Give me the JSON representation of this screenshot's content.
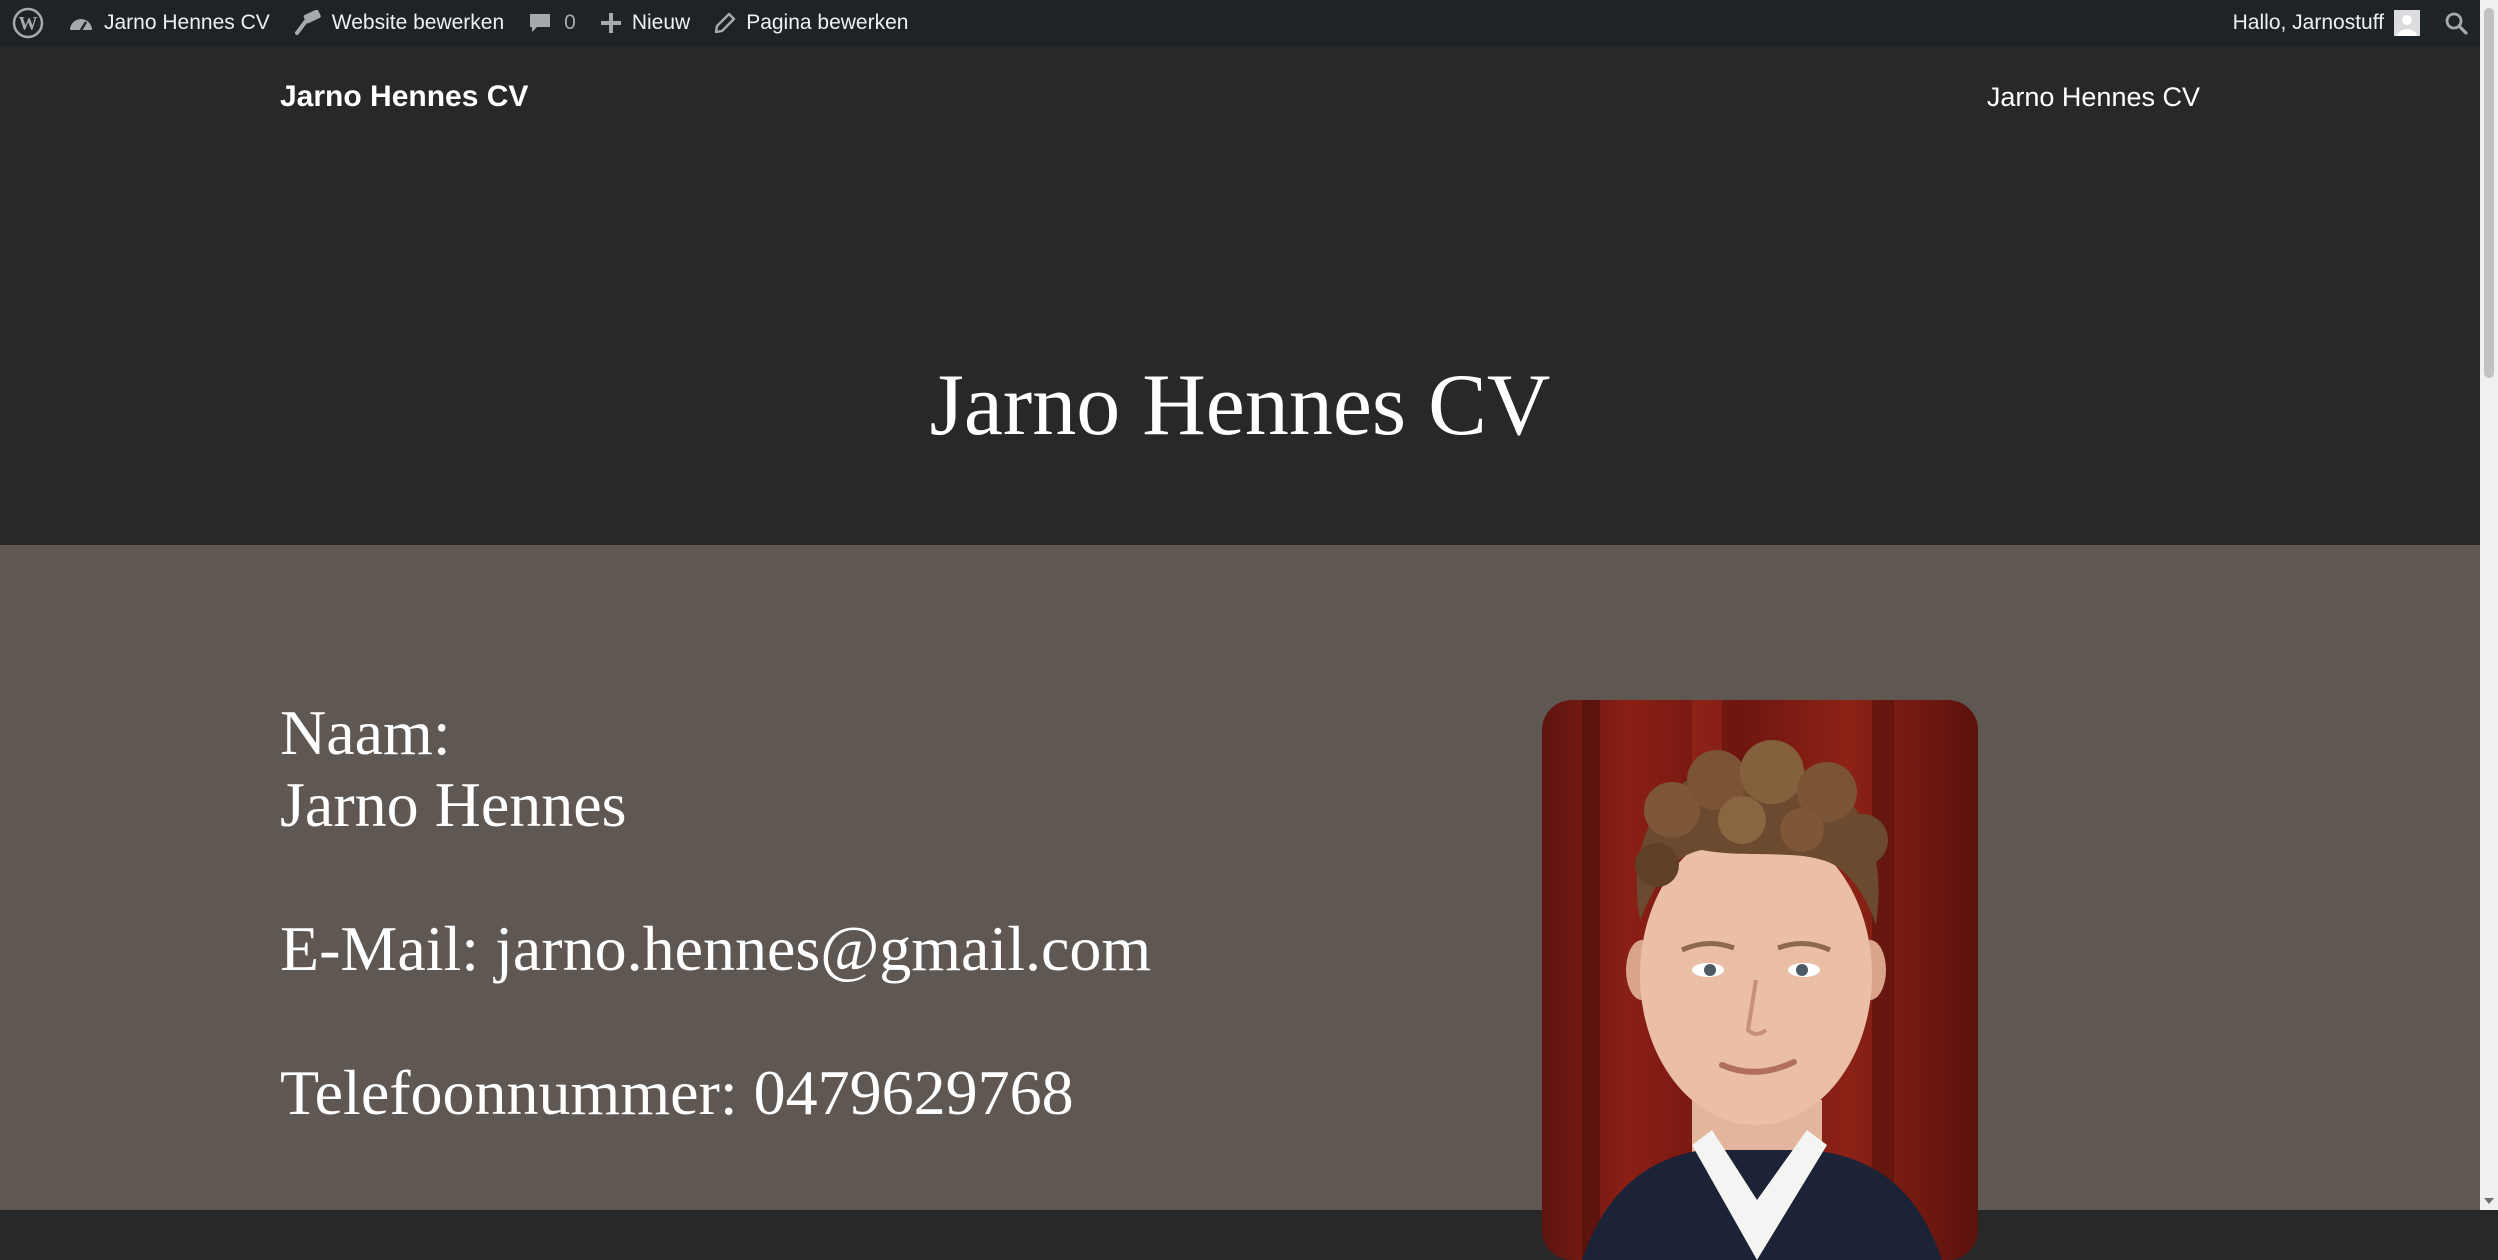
{
  "adminbar": {
    "site_name": "Jarno Hennes CV",
    "edit_site": "Website bewerken",
    "comments_count": "0",
    "new_label": "Nieuw",
    "edit_page": "Pagina bewerken",
    "greeting": "Hallo, Jarnostuff"
  },
  "header": {
    "site_title": "Jarno Hennes CV",
    "nav_link": "Jarno Hennes CV",
    "page_title": "Jarno Hennes CV"
  },
  "content": {
    "name_label": "Naam:",
    "name_value": "Jarno Hennes",
    "email": "E-Mail: jarno.hennes@gmail.com",
    "phone": "Telefoonnummer: 0479629768"
  },
  "colors": {
    "adminbar_bg": "#1d2327",
    "header_bg": "#282828",
    "content_bg": "#5e5752",
    "text": "#ffffff"
  }
}
